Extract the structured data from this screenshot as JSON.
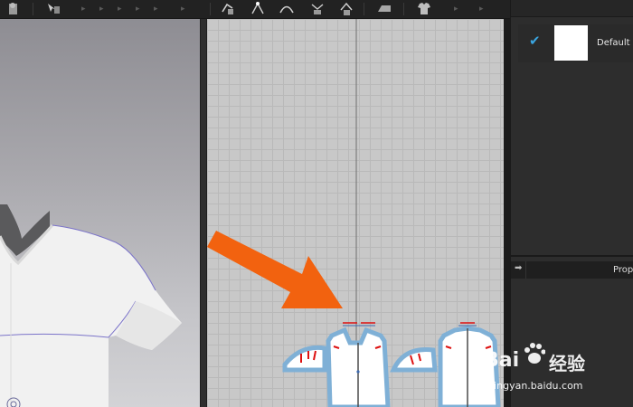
{
  "toolbar": {
    "icons": [
      "avatar-icon",
      "pattern-tool-icon",
      "segment-tool-icon",
      "point-tool-icon",
      "curve-tool-icon",
      "sewing-tool-icon",
      "free-sewing-icon",
      "iron-icon",
      "garment-icon"
    ]
  },
  "fabric_panel": {
    "item_label": "Default F",
    "checked": true,
    "swatch_color": "#ffffff"
  },
  "property_panel": {
    "title": "Prop"
  },
  "watermark": {
    "brand_left": "Bai",
    "brand_right": "经验",
    "url": "jingyan.baidu.com"
  },
  "colors": {
    "arrow": "#f2620f",
    "seam_outline": "#7fb0d6",
    "check": "#3aa5e0"
  }
}
